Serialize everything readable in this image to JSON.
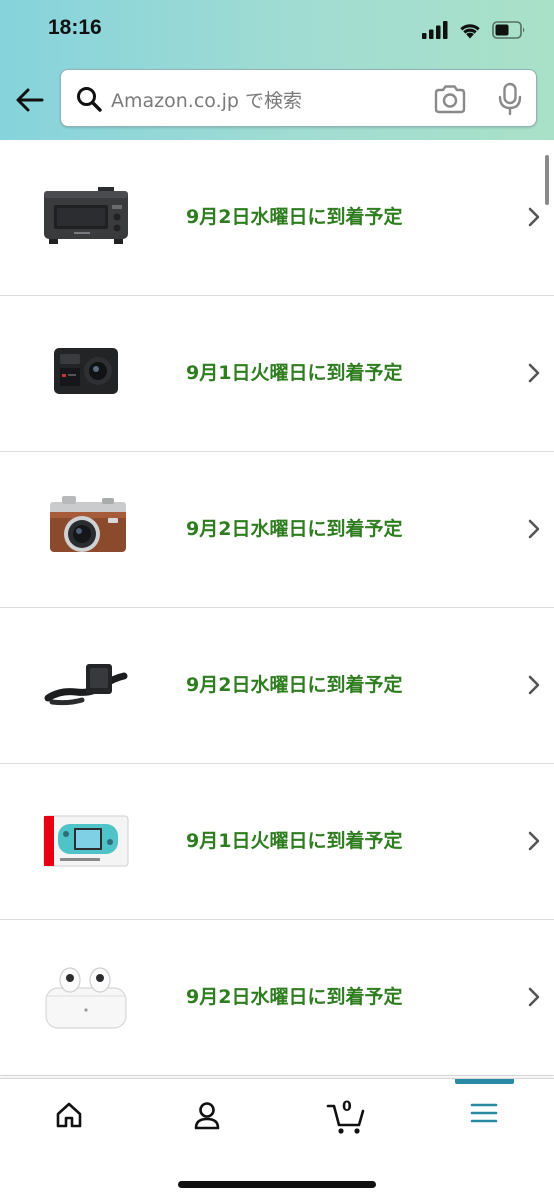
{
  "status_bar": {
    "time": "18:16",
    "icons": [
      "signal-icon",
      "wifi-icon",
      "battery-icon"
    ]
  },
  "header": {
    "back_icon": "arrow-left-icon",
    "search": {
      "placeholder": "Amazon.co.jp で検索",
      "icons": [
        "search-icon",
        "camera-icon",
        "mic-icon"
      ]
    }
  },
  "orders": [
    {
      "product": "toaster",
      "delivery": "9月2日水曜日に到着予定"
    },
    {
      "product": "action-camera",
      "delivery": "9月1日火曜日に到着予定"
    },
    {
      "product": "mirrorless-camera",
      "delivery": "9月2日水曜日に到着予定"
    },
    {
      "product": "strap-stand",
      "delivery": "9月2日水曜日に到着予定"
    },
    {
      "product": "game-console",
      "delivery": "9月1日火曜日に到着予定"
    },
    {
      "product": "earbuds",
      "delivery": "9月2日水曜日に到着予定"
    }
  ],
  "bottom_nav": {
    "items": [
      "home-icon",
      "account-icon",
      "cart-icon",
      "menu-icon"
    ],
    "cart_count": "0",
    "active": "menu-icon"
  },
  "colors": {
    "delivery_text": "#2e7d1f",
    "active_tab": "#2a8aa3",
    "header_gradient_start": "#86d3dc",
    "header_gradient_end": "#a9e1c8"
  }
}
